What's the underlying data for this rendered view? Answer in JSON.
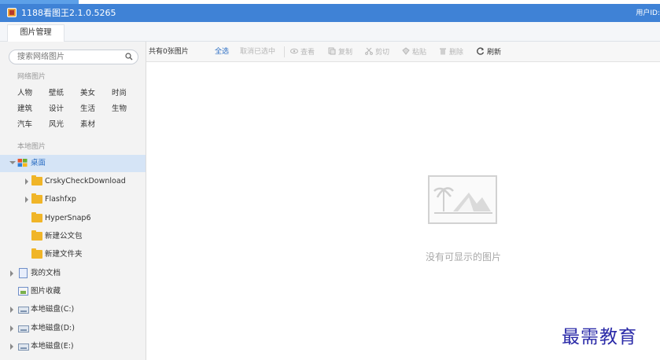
{
  "window": {
    "title": "1188看图王2.1.0.5265",
    "user_label": "用户ID:"
  },
  "tabs": [
    {
      "label": "图片管理"
    }
  ],
  "search": {
    "placeholder": "搜索网络图片"
  },
  "sidebar": {
    "network_label": "网络图片",
    "categories": [
      "人物",
      "壁纸",
      "美女",
      "时尚",
      "建筑",
      "设计",
      "生活",
      "生物",
      "汽车",
      "风光",
      "素材"
    ],
    "local_label": "本地图片",
    "tree": [
      {
        "label": "桌面",
        "expanded": true,
        "selected": true
      },
      {
        "label": "CrskyCheckDownload"
      },
      {
        "label": "Flashfxp"
      },
      {
        "label": "HyperSnap6"
      },
      {
        "label": "新建公文包"
      },
      {
        "label": "新建文件夹"
      },
      {
        "label": "我的文档"
      },
      {
        "label": "图片收藏"
      },
      {
        "label": "本地磁盘(C:)"
      },
      {
        "label": "本地磁盘(D:)"
      },
      {
        "label": "本地磁盘(E:)"
      }
    ]
  },
  "toolbar": {
    "count": "共有0张图片",
    "select_all": "全选",
    "deselect": "取消已选中",
    "view": "查看",
    "copy": "复制",
    "cut": "剪切",
    "paste": "粘贴",
    "delete": "删除",
    "refresh": "刷新"
  },
  "content": {
    "empty_message": "没有可显示的图片"
  },
  "watermark": "最需教育",
  "colors": {
    "titlebar": "#3f82d6",
    "accent": "#2d6fc4",
    "selected_row": "#d5e4f6",
    "folder": "#f0b528"
  }
}
